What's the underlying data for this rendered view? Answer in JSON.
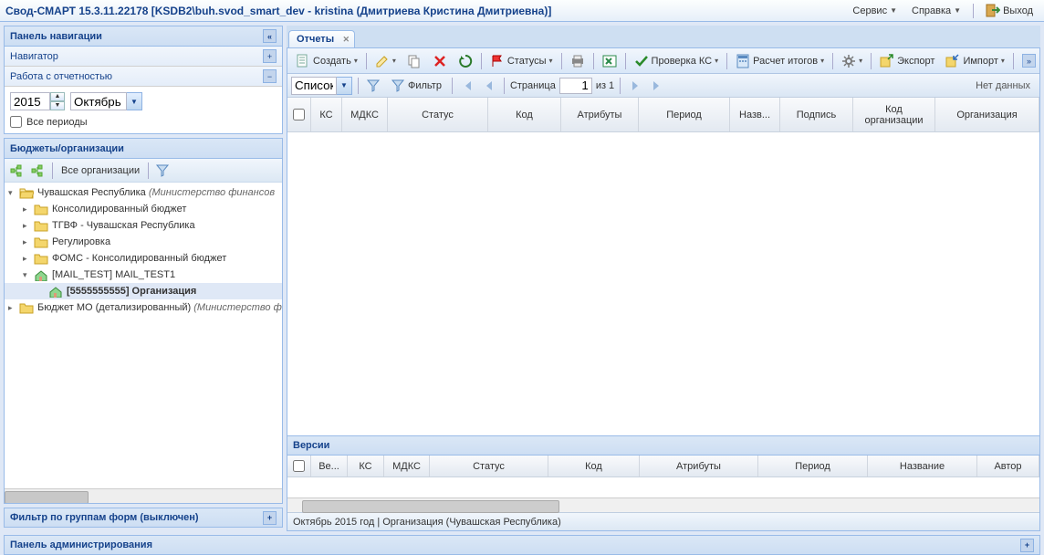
{
  "header": {
    "title": "Свод-СМАРТ 15.3.11.22178 [KSDB2\\buh.svod_smart_dev - kristina (Дмитриева Кристина Дмитриевна)]",
    "service": "Сервис",
    "help": "Справка",
    "exit": "Выход"
  },
  "nav": {
    "panel_title": "Панель навигации",
    "navigator": "Навигатор",
    "reports_work": "Работа с отчетностью",
    "year": "2015",
    "month": "Октябрь",
    "all_periods": "Все периоды"
  },
  "budgets": {
    "title": "Бюджеты/организации",
    "all_orgs": "Все организации",
    "tree": {
      "n0": "Чувашская Республика",
      "n0_suffix": "(Министерство финансов",
      "n1": "Консолидированный бюджет",
      "n2": "ТГВФ - Чувашская Республика",
      "n3": "Регулировка",
      "n4": "ФОМС - Консолидированный бюджет",
      "n5": "[MAIL_TEST] MAIL_TEST1",
      "n6": "[5555555555] Организация",
      "n7": "Бюджет МО (детализированный)",
      "n7_suffix": "(Министерство ф"
    }
  },
  "filter_bar": "Фильтр по группам форм (выключен)",
  "admin_bar": "Панель администрирования",
  "tabs": {
    "reports": "Отчеты"
  },
  "toolbar": {
    "create": "Создать",
    "statuses": "Статусы",
    "check_ks": "Проверка КС",
    "calc_totals": "Расчет итогов",
    "export": "Экспорт",
    "import": "Импорт"
  },
  "toolbar2": {
    "list": "Список",
    "filter": "Фильтр",
    "page_lbl": "Страница",
    "page_num": "1",
    "of": "из 1",
    "nodata": "Нет данных"
  },
  "grid1": {
    "c1": "КС",
    "c2": "МДКС",
    "c3": "Статус",
    "c4": "Код",
    "c5": "Атрибуты",
    "c6": "Период",
    "c7": "Назв...",
    "c8": "Подпись",
    "c9": "Код организации",
    "c10": "Организация"
  },
  "versions": {
    "title": "Версии"
  },
  "grid2": {
    "c1": "Ве...",
    "c2": "КС",
    "c3": "МДКС",
    "c4": "Статус",
    "c5": "Код",
    "c6": "Атрибуты",
    "c7": "Период",
    "c8": "Название",
    "c9": "Автор"
  },
  "status": "Октябрь 2015 год | Организация (Чувашская Республика)"
}
